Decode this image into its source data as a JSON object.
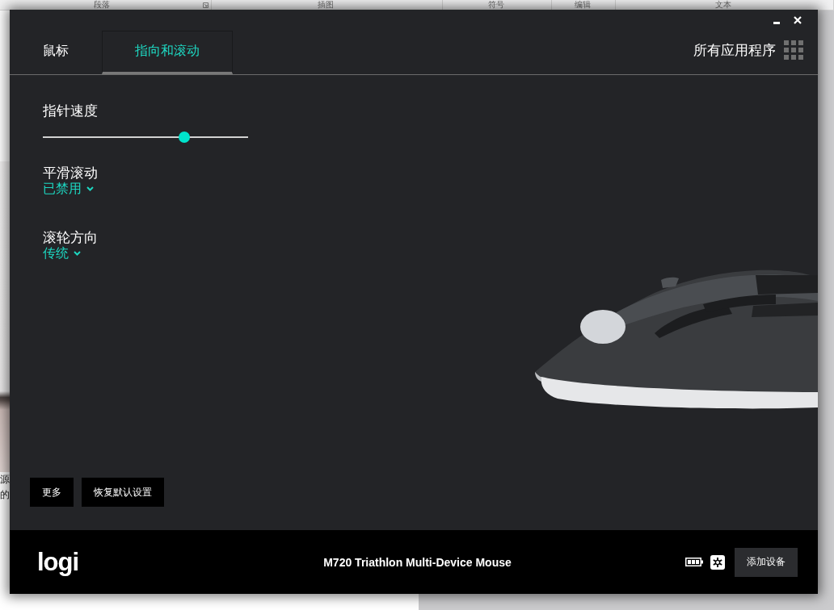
{
  "background_app": {
    "ribbon_groups": [
      "段落",
      "插图",
      "符号",
      "编辑",
      "文本"
    ],
    "document_lines": [
      "源",
      "的"
    ]
  },
  "tabs": [
    {
      "label": "鼠标",
      "selected": false
    },
    {
      "label": "指向和滚动",
      "selected": true
    }
  ],
  "all_apps": {
    "label": "所有应用程序"
  },
  "settings": [
    {
      "kind": "slider",
      "label": "指针速度",
      "level": 0.69
    },
    {
      "kind": "dropdown",
      "label": "平滑滚动",
      "value": "已禁用"
    },
    {
      "kind": "dropdown",
      "label": "滚轮方向",
      "value": "传统"
    }
  ],
  "buttons": [
    "更多",
    "恢复默认设置"
  ],
  "footer": {
    "logo": "logi",
    "device_name": "M720 Triathlon Multi-Device Mouse",
    "button": "添加设备"
  }
}
